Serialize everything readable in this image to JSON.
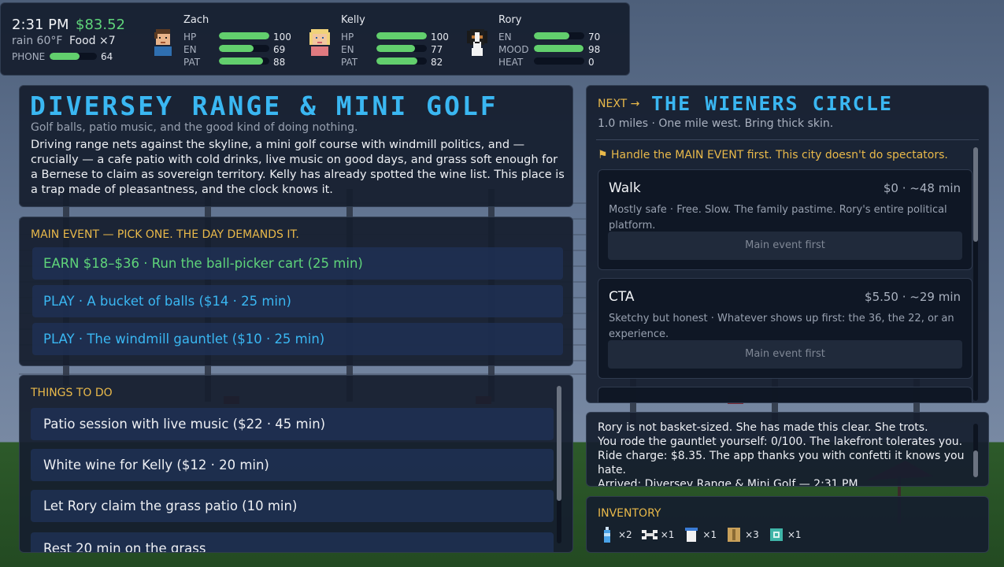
{
  "hud": {
    "time": "2:31 PM",
    "money": "$83.52",
    "weather": "rain 60°F",
    "food": "Food ×7",
    "phone_label": "PHONE",
    "phone_value": "64",
    "phone_level": 0.64
  },
  "characters": [
    {
      "name": "Zach",
      "avatar": "boy-avatar-icon",
      "stats": [
        {
          "label": "HP",
          "value": "100",
          "level": 1.0
        },
        {
          "label": "EN",
          "value": "69",
          "level": 0.69
        },
        {
          "label": "PAT",
          "value": "88",
          "level": 0.88
        }
      ]
    },
    {
      "name": "Kelly",
      "avatar": "girl-avatar-icon",
      "stats": [
        {
          "label": "HP",
          "value": "100",
          "level": 1.0
        },
        {
          "label": "EN",
          "value": "77",
          "level": 0.77
        },
        {
          "label": "PAT",
          "value": "82",
          "level": 0.82
        }
      ]
    },
    {
      "name": "Rory",
      "avatar": "dog-avatar-icon",
      "stats": [
        {
          "label": "EN",
          "value": "70",
          "level": 0.7
        },
        {
          "label": "MOOD",
          "value": "98",
          "level": 0.98
        },
        {
          "label": "HEAT",
          "value": "0",
          "level": 0.0
        }
      ]
    }
  ],
  "location": {
    "title": "DIVERSEY RANGE & MINI GOLF",
    "subtitle": "Golf balls, patio music, and the good kind of doing nothing.",
    "description": "Driving range nets against the skyline, a mini golf course with windmill politics, and — crucially — a cafe patio with cold drinks, live music on good days, and grass soft enough for a Bernese to claim as sovereign territory. Kelly has already spotted the wine list. This place is a trap made of pleasantness, and the clock knows it."
  },
  "main_event": {
    "heading": "MAIN EVENT — PICK ONE. THE DAY DEMANDS IT.",
    "options": [
      {
        "label": "EARN $18–$36 · Run the ball-picker cart  (25 min)",
        "kind": "earn"
      },
      {
        "label": "PLAY · A bucket of balls  ($14 · 25 min)",
        "kind": "play"
      },
      {
        "label": "PLAY · The windmill gauntlet  ($10 · 25 min)",
        "kind": "play"
      }
    ]
  },
  "things": {
    "heading": "THINGS TO DO",
    "items": [
      "Patio session with live music  ($22 · 45 min)",
      "White wine for Kelly  ($12 · 20 min)",
      "Let Rory claim the grass patio  (10 min)",
      "Rest 20 min on the grass"
    ]
  },
  "next": {
    "label": "NEXT →",
    "destination": "THE WIENERS CIRCLE",
    "distance": "1.0 miles · One mile west. Bring thick skin.",
    "warning": "⚑ Handle the MAIN EVENT first. This city doesn't do spectators.",
    "routes": [
      {
        "name": "Walk",
        "cost": "$0 · ~48 min",
        "desc": "Mostly safe  ·  Free. Slow. The family pastime. Rory's entire political platform.",
        "button": "Main event first"
      },
      {
        "name": "CTA",
        "cost": "$5.50 · ~29 min",
        "desc": "Sketchy but honest  ·  Whatever shows up first: the 36, the 22, or an experience.",
        "button": "Main event first"
      }
    ]
  },
  "log": {
    "lines": [
      "Rory is not basket-sized. She has made this clear. She trots.",
      "You rode the gauntlet yourself: 0/100. The lakefront tolerates you.",
      "Ride charge: $8.35. The app thanks you with confetti it knows you hate.",
      "Arrived: Diversey Range & Mini Golf — 2:31 PM"
    ]
  },
  "inventory": {
    "heading": "INVENTORY",
    "items": [
      {
        "icon": "water-bottle-icon",
        "count": "×2"
      },
      {
        "icon": "dog-bone-icon",
        "count": "×1"
      },
      {
        "icon": "coffee-cup-icon",
        "count": "×1"
      },
      {
        "icon": "snack-bag-icon",
        "count": "×3"
      },
      {
        "icon": "pill-box-icon",
        "count": "×1"
      }
    ]
  },
  "colors": {
    "accent_blue": "#3ab7f2",
    "accent_green": "#5fd47a",
    "accent_gold": "#e9b94a",
    "bar_fill": "#62cf6d"
  }
}
